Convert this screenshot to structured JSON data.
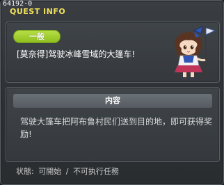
{
  "window": {
    "quest_id": "64192-0",
    "title": "QUEST INFO"
  },
  "quest": {
    "category": "一般",
    "title": "[莫奈得]驾驶冰峰雪域的大篷车!",
    "npc_icon": "npc-portrait-girl-icon"
  },
  "content": {
    "header": "内容",
    "description": "驾驶大篷车把阿布鲁村民们送到目的地，即可获得奖励!"
  },
  "status": {
    "label": "状態:",
    "value1": "可開始",
    "separator": "/",
    "value2": "不可执行任務"
  },
  "colors": {
    "title_yellow": "#f0e15a",
    "badge_green": "#9ccc2a"
  }
}
